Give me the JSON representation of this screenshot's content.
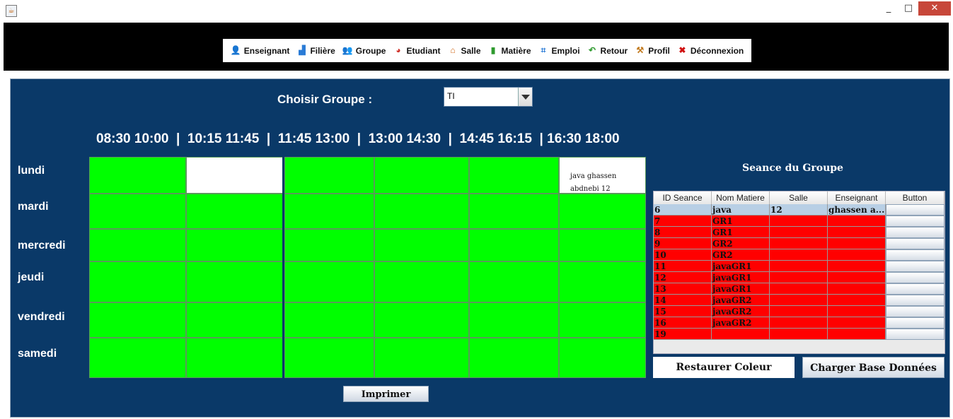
{
  "window": {
    "minimize_glyph": "_",
    "maximize_glyph": "□",
    "close_glyph": "✕"
  },
  "menu": {
    "items": [
      {
        "label": "Enseignant",
        "icon": "user-icon",
        "glyph": "👤",
        "color": "#333333"
      },
      {
        "label": "Filière",
        "icon": "blocks-icon",
        "glyph": "▟",
        "color": "#2a7bd6"
      },
      {
        "label": "Groupe",
        "icon": "group-icon",
        "glyph": "👥",
        "color": "#c7a52a"
      },
      {
        "label": "Etudiant",
        "icon": "student-icon",
        "glyph": "◕",
        "color": "#d0342c"
      },
      {
        "label": "Salle",
        "icon": "home-icon",
        "glyph": "⌂",
        "color": "#d06a1c"
      },
      {
        "label": "Matière",
        "icon": "book-icon",
        "glyph": "▮",
        "color": "#2e9a2e"
      },
      {
        "label": "Emploi",
        "icon": "schedule-icon",
        "glyph": "⌗",
        "color": "#2a7bd6"
      },
      {
        "label": "Retour",
        "icon": "back-arrow-icon",
        "glyph": "↶",
        "color": "#2e9a2e"
      },
      {
        "label": "Profil",
        "icon": "tools-icon",
        "glyph": "⚒",
        "color": "#c27a1e"
      },
      {
        "label": "Déconnexion",
        "icon": "close-icon",
        "glyph": "✖",
        "color": "#d01010"
      }
    ]
  },
  "selector": {
    "label": "Choisir Groupe  :",
    "selected": "TI"
  },
  "timeslots_text": "08:30 10:00  |  10:15 11:45  |  11:45 13:00  |  13:00 14:30  |  14:45 16:15  | 16:30 18:00",
  "days": [
    "lundi",
    "mardi",
    "mercredi",
    "jeudi",
    "vendredi",
    "samedi"
  ],
  "grid": {
    "cell_color": "#00ff00",
    "empty_color": "#ffffff",
    "filled": {
      "lundi_1": {
        "color": "#ffffff"
      },
      "lundi_5": {
        "line1": "java ghassen",
        "line2": "abdnebi 12"
      }
    }
  },
  "seance": {
    "title": "Seance du Groupe",
    "columns": [
      "ID Seance",
      "Nom Matiere",
      "Salle",
      "Enseignant",
      "Button"
    ],
    "rows": [
      {
        "id": "6",
        "matiere": "java",
        "salle": "12",
        "enseignant": "ghassen a...",
        "selected": true
      },
      {
        "id": "7",
        "matiere": "GR1",
        "salle": "",
        "enseignant": ""
      },
      {
        "id": "8",
        "matiere": "GR1",
        "salle": "",
        "enseignant": ""
      },
      {
        "id": "9",
        "matiere": "GR2",
        "salle": "",
        "enseignant": ""
      },
      {
        "id": "10",
        "matiere": "GR2",
        "salle": "",
        "enseignant": ""
      },
      {
        "id": "11",
        "matiere": "javaGR1",
        "salle": "",
        "enseignant": ""
      },
      {
        "id": "12",
        "matiere": "javaGR1",
        "salle": "",
        "enseignant": ""
      },
      {
        "id": "13",
        "matiere": "javaGR1",
        "salle": "",
        "enseignant": ""
      },
      {
        "id": "14",
        "matiere": "javaGR2",
        "salle": "",
        "enseignant": ""
      },
      {
        "id": "15",
        "matiere": "javaGR2",
        "salle": "",
        "enseignant": ""
      },
      {
        "id": "16",
        "matiere": "javaGR2",
        "salle": "",
        "enseignant": ""
      },
      {
        "id": "19",
        "matiere": "",
        "salle": "",
        "enseignant": ""
      }
    ],
    "row_color": "#ff0000",
    "selected_color": "#b8cfe5"
  },
  "buttons": {
    "restaurer": "Restaurer Coleur",
    "charger": "Charger Base Données",
    "imprimer": "Imprimer"
  },
  "colors": {
    "panel_bg": "#0a3968",
    "menu_bar_bg": "#000000"
  }
}
